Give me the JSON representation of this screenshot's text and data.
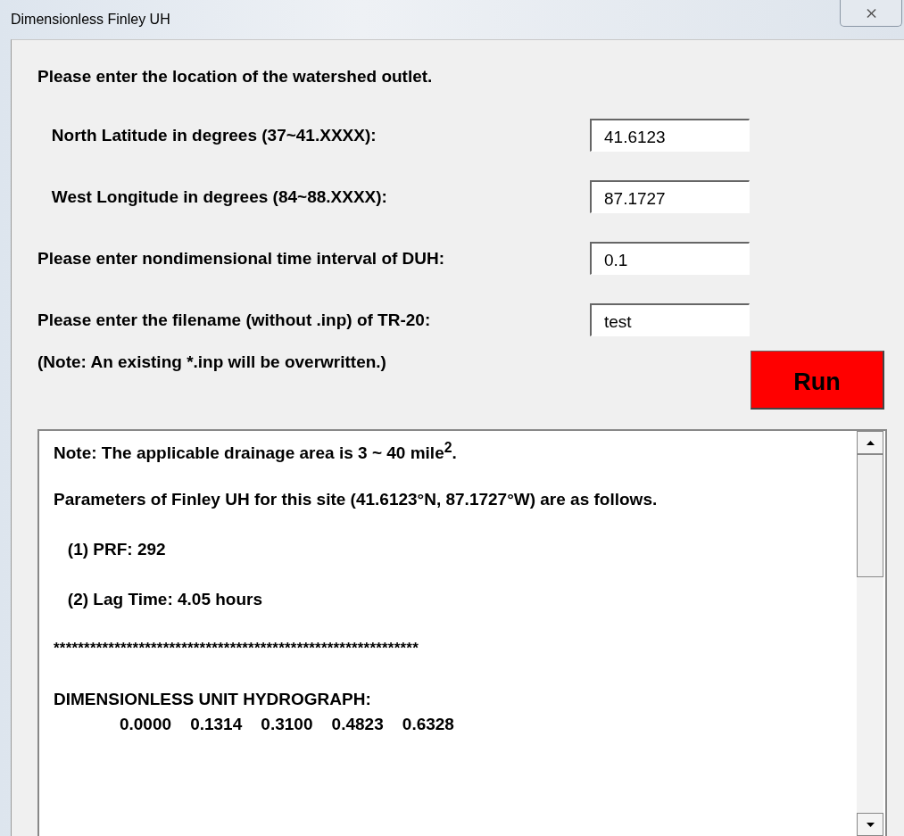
{
  "window": {
    "title": "Dimensionless Finley UH",
    "close": "⨯"
  },
  "heading": "Please enter the location of the watershed outlet.",
  "fields": [
    {
      "label": "   North Latitude in degrees (37~41.XXXX):",
      "value": "41.6123"
    },
    {
      "label": "   West Longitude in degrees (84~88.XXXX):",
      "value": "87.1727"
    },
    {
      "label": "Please enter nondimensional time interval of DUH:",
      "value": "0.1"
    },
    {
      "label": "Please enter the filename (without .inp) of TR-20:",
      "value": "test"
    }
  ],
  "note": "(Note: An existing *.inp will be overwritten.)",
  "run_button": "Run",
  "output": {
    "lines": [
      {
        "kind": "note",
        "text": "Note: The applicable drainage area is 3 ~ 40 mile$^{2}$."
      },
      {
        "kind": "text",
        "text": "Parameters of Finley UH for this site (41.6123°N, 87.1727°W) are as follows."
      },
      {
        "kind": "text",
        "text": "   (1) PRF: 292"
      },
      {
        "kind": "text",
        "text": "   (2) Lag Time: 4.05 hours"
      },
      {
        "kind": "rule",
        "text": "************************************************************"
      },
      {
        "kind": "header",
        "text": "DIMENSIONLESS UNIT HYDROGRAPH:"
      },
      {
        "kind": "values",
        "text": "              0.0000    0.1314    0.3100    0.4823    0.6328"
      }
    ]
  }
}
